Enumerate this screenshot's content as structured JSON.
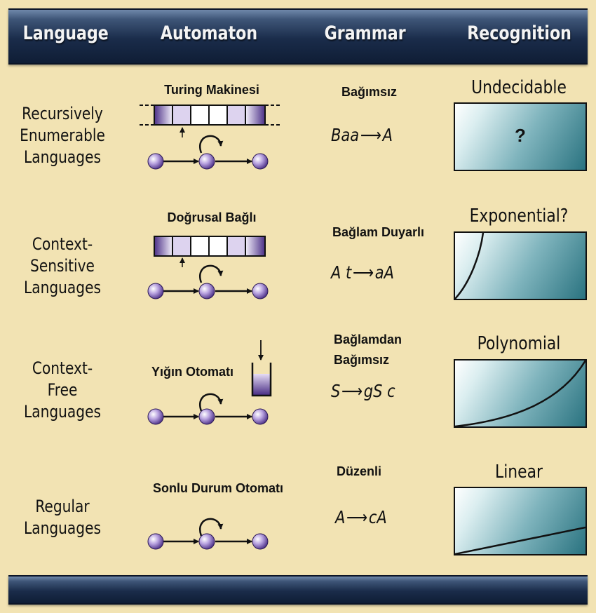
{
  "header": {
    "language": "Language",
    "automaton": "Automaton",
    "grammar": "Grammar",
    "recognition": "Recognition"
  },
  "rows": [
    {
      "language": "Recursively\nEnumerable\nLanguages",
      "automaton": "Turing Makinesi",
      "grammar": "Bağımsız",
      "rule_left": "Baa",
      "rule_right": "A",
      "recognition": "Undecidable",
      "box_text": "?"
    },
    {
      "language": "Context-\nSensitive\nLanguages",
      "automaton": "Doğrusal Bağlı",
      "grammar": "Bağlam Duyarlı",
      "rule_left": "A t",
      "rule_right": "aA",
      "recognition": "Exponential?"
    },
    {
      "language": "Context-\nFree\nLanguages",
      "automaton": "Yığın Otomatı",
      "grammar": "Bağlamdan\nBağımsız",
      "rule_left": "S",
      "rule_right": "gS c",
      "recognition": "Polynomial"
    },
    {
      "language": "Regular\nLanguages",
      "automaton": "Sonlu Durum Otomatı",
      "grammar": "Düzenli",
      "rule_left": "A",
      "rule_right": "cA",
      "recognition": "Linear"
    }
  ],
  "colors": {
    "background": "#f2e3b3",
    "header_bar": "#1a2c4a",
    "state_fill": "#8b6fc0",
    "box_teal": "#2a7380"
  }
}
